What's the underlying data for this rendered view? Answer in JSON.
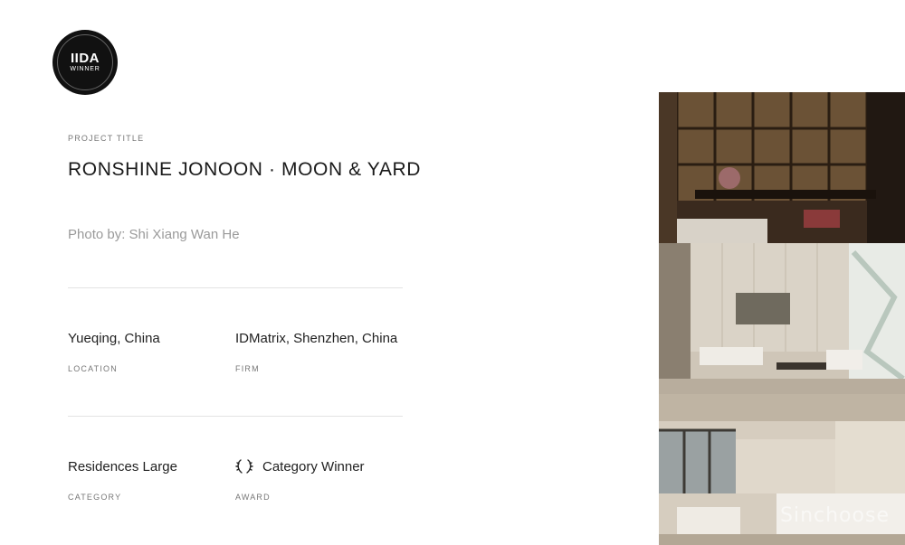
{
  "badge": {
    "title": "IIDA",
    "subtitle": "WINNER"
  },
  "project": {
    "title_label": "PROJECT TITLE",
    "title": "RONSHINE JONOON · MOON & YARD",
    "photo_credit": "Photo by: Shi Xiang Wan He"
  },
  "details": {
    "location": {
      "value": "Yueqing, China",
      "label": "LOCATION"
    },
    "firm": {
      "value": "IDMatrix, Shenzhen, China",
      "label": "FIRM"
    },
    "category": {
      "value": "Residences Large",
      "label": "CATEGORY"
    },
    "award": {
      "value": "Category Winner",
      "label": "AWARD",
      "icon": "laurel-icon"
    }
  },
  "watermark": "Sinchoose",
  "colors": {
    "text": "#222222",
    "muted": "#9a9a9a",
    "badge": "#111111",
    "rule": "#e3e3e3"
  }
}
